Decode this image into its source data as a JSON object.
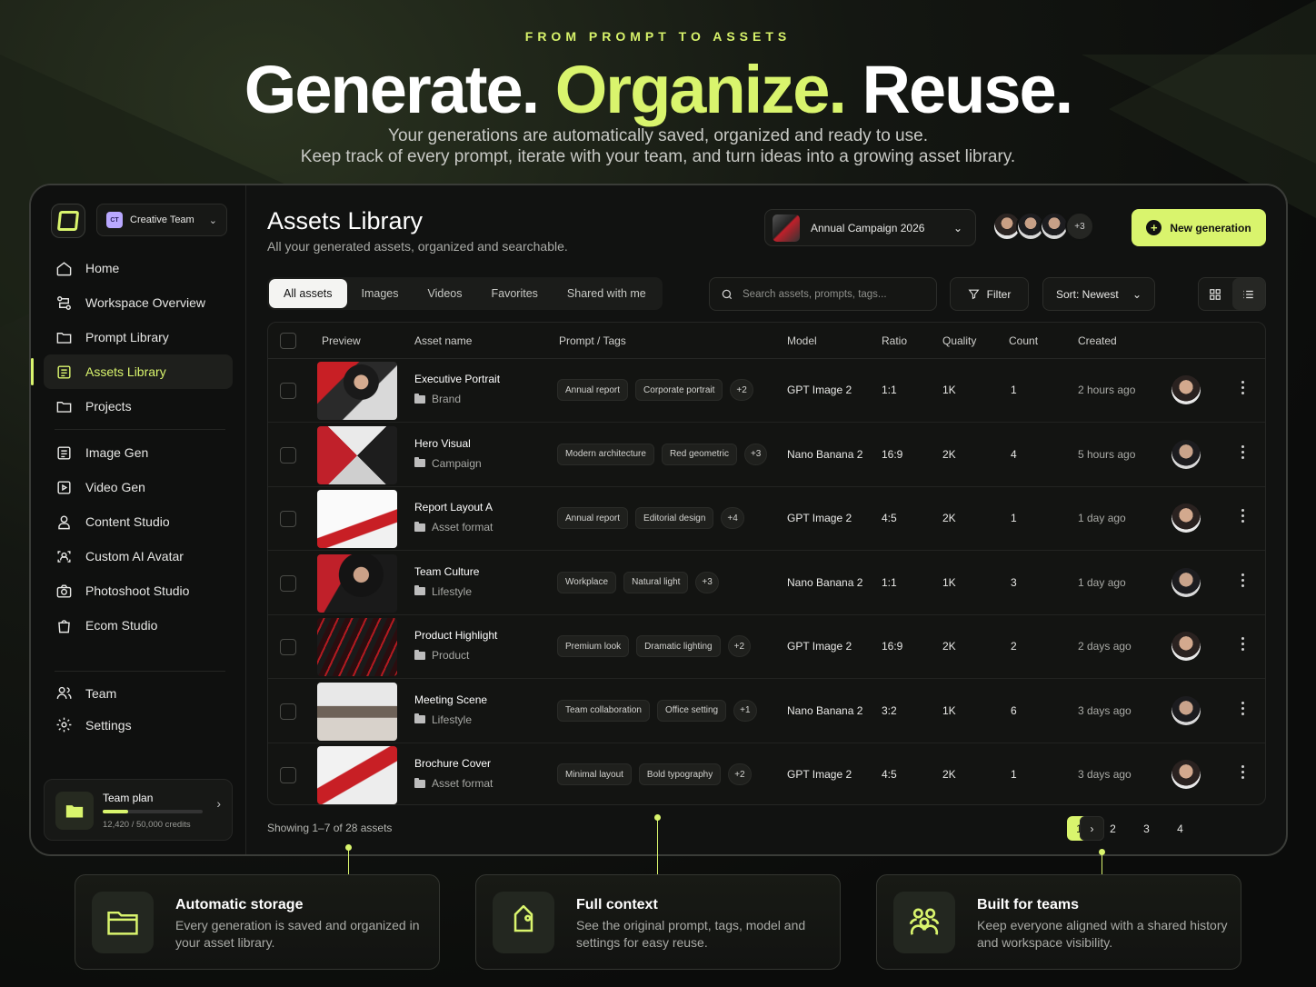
{
  "hero": {
    "eyebrow": "FROM PROMPT TO ASSETS",
    "headline_part1": "Generate.",
    "headline_part2": "Organize.",
    "headline_part3": "Reuse.",
    "sub_line1": "Your generations are automatically saved, organized and ready to use.",
    "sub_line2": "Keep track of every prompt, iterate with your team, and turn ideas into a growing asset library."
  },
  "sidebar": {
    "team_badge": "CT",
    "team_name": "Creative Team",
    "items": [
      {
        "label": "Home",
        "icon": "home-icon"
      },
      {
        "label": "Workspace Overview",
        "icon": "workflow-icon"
      },
      {
        "label": "Prompt Library",
        "icon": "folder-icon"
      },
      {
        "label": "Assets Library",
        "icon": "library-icon"
      },
      {
        "label": "Projects",
        "icon": "folder-icon"
      },
      {
        "label": "Image Gen",
        "icon": "image-gen-icon"
      },
      {
        "label": "Video Gen",
        "icon": "video-icon"
      },
      {
        "label": "Content Studio",
        "icon": "user-icon"
      },
      {
        "label": "Custom AI Avatar",
        "icon": "avatar-scan-icon"
      },
      {
        "label": "Photoshoot Studio",
        "icon": "camera-icon"
      },
      {
        "label": "Ecom Studio",
        "icon": "shopping-bag-icon"
      },
      {
        "label": "Team",
        "icon": "team-icon"
      },
      {
        "label": "Settings",
        "icon": "gear-icon"
      }
    ],
    "plan": {
      "title": "Team plan",
      "credits": "12,420 / 50,000 credits",
      "usage_fraction": 0.25
    }
  },
  "header": {
    "title": "Assets Library",
    "subtitle": "All your generated assets, organized and searchable.",
    "campaign": "Annual Campaign 2026",
    "members_more": "+3",
    "new_generation": "New generation"
  },
  "toolbar": {
    "tabs": [
      "All assets",
      "Images",
      "Videos",
      "Favorites",
      "Shared with me"
    ],
    "search_placeholder": "Search assets, prompts, tags...",
    "filter": "Filter",
    "sort": "Sort: Newest"
  },
  "table": {
    "columns": [
      "Preview",
      "Asset name",
      "Prompt / Tags",
      "Model",
      "Ratio",
      "Quality",
      "Count",
      "Created"
    ],
    "rows": [
      {
        "name": "Executive Portrait",
        "folder": "Brand",
        "tags": [
          "Annual report",
          "Corporate portrait"
        ],
        "more": "+2",
        "model": "GPT Image 2",
        "ratio": "1:1",
        "quality": "1K",
        "count": "1",
        "created": "2 hours ago"
      },
      {
        "name": "Hero Visual",
        "folder": "Campaign",
        "tags": [
          "Modern architecture",
          "Red geometric"
        ],
        "more": "+3",
        "model": "Nano Banana 2",
        "ratio": "16:9",
        "quality": "2K",
        "count": "4",
        "created": "5 hours ago"
      },
      {
        "name": "Report Layout A",
        "folder": "Asset format",
        "tags": [
          "Annual report",
          "Editorial design"
        ],
        "more": "+4",
        "model": "GPT Image 2",
        "ratio": "4:5",
        "quality": "2K",
        "count": "1",
        "created": "1 day ago"
      },
      {
        "name": "Team Culture",
        "folder": "Lifestyle",
        "tags": [
          "Workplace",
          "Natural light"
        ],
        "more": "+3",
        "model": "Nano Banana 2",
        "ratio": "1:1",
        "quality": "1K",
        "count": "3",
        "created": "1 day ago"
      },
      {
        "name": "Product Highlight",
        "folder": "Product",
        "tags": [
          "Premium look",
          "Dramatic lighting"
        ],
        "more": "+2",
        "model": "GPT Image 2",
        "ratio": "16:9",
        "quality": "2K",
        "count": "2",
        "created": "2 days ago"
      },
      {
        "name": "Meeting Scene",
        "folder": "Lifestyle",
        "tags": [
          "Team collaboration",
          "Office setting"
        ],
        "more": "+1",
        "model": "Nano Banana 2",
        "ratio": "3:2",
        "quality": "1K",
        "count": "6",
        "created": "3 days ago"
      },
      {
        "name": "Brochure Cover",
        "folder": "Asset format",
        "tags": [
          "Minimal layout",
          "Bold typography"
        ],
        "more": "+2",
        "model": "GPT Image 2",
        "ratio": "4:5",
        "quality": "2K",
        "count": "1",
        "created": "3 days ago"
      }
    ]
  },
  "footer": {
    "showing": "Showing 1–7 of 28 assets",
    "pages": [
      "1",
      "2",
      "3",
      "4"
    ],
    "current_page": "1"
  },
  "features": [
    {
      "title": "Automatic storage",
      "text": "Every generation is saved and organized in your asset library.",
      "icon": "folder-icon"
    },
    {
      "title": "Full context",
      "text": "See the original prompt, tags, model and settings for easy reuse.",
      "icon": "tag-icon"
    },
    {
      "title": "Built for teams",
      "text": "Keep everyone aligned with a shared history and workspace visibility.",
      "icon": "team-icon"
    }
  ],
  "colors": {
    "accent": "#d9f46d",
    "background": "#0b0c0b",
    "panel": "#111211"
  }
}
